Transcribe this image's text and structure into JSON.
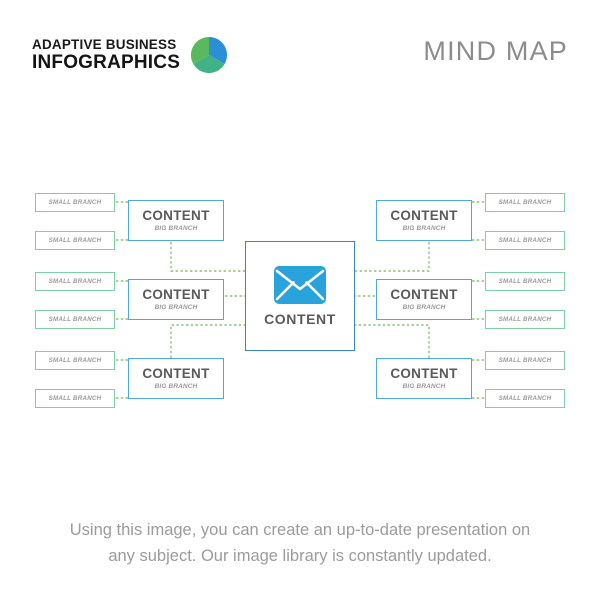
{
  "header": {
    "logo_line1": "ADAPTIVE BUSINESS",
    "logo_line2": "INFOGRAPHICS",
    "logo_icon": "three-segment-circle",
    "title": "MIND MAP",
    "colors": {
      "logo_blue": "#2a8fd4",
      "logo_green": "#5cb85c",
      "logo_teal": "#3fb286",
      "title_gray": "#8c8c8c"
    }
  },
  "diagram": {
    "type": "mind-map",
    "center": {
      "label": "CONTENT",
      "icon": "envelope-icon",
      "border_color": "#3a86b8",
      "icon_color": "#29a3dc"
    },
    "colors": {
      "big_branch_border": "#4eaadd",
      "small_branch_border": "#7ecfa6",
      "connector": "#8dbf79",
      "big_text": "#5a5a5a",
      "sub_text": "#9a9a9a"
    },
    "big_branches": [
      {
        "title": "CONTENT",
        "subtitle": "BIG BRANCH",
        "side": "left",
        "row": 1
      },
      {
        "title": "CONTENT",
        "subtitle": "BIG BRANCH",
        "side": "left",
        "row": 2
      },
      {
        "title": "CONTENT",
        "subtitle": "BIG BRANCH",
        "side": "left",
        "row": 3
      },
      {
        "title": "CONTENT",
        "subtitle": "BIG BRANCH",
        "side": "right",
        "row": 1
      },
      {
        "title": "CONTENT",
        "subtitle": "BIG BRANCH",
        "side": "right",
        "row": 2
      },
      {
        "title": "CONTENT",
        "subtitle": "BIG BRANCH",
        "side": "right",
        "row": 3
      }
    ],
    "small_branches": [
      {
        "label": "SMALL BRANCH",
        "side": "left",
        "row": 1,
        "slot": "upper"
      },
      {
        "label": "SMALL BRANCH",
        "side": "left",
        "row": 1,
        "slot": "lower"
      },
      {
        "label": "SMALL BRANCH",
        "side": "left",
        "row": 2,
        "slot": "upper"
      },
      {
        "label": "SMALL BRANCH",
        "side": "left",
        "row": 2,
        "slot": "lower"
      },
      {
        "label": "SMALL BRANCH",
        "side": "left",
        "row": 3,
        "slot": "upper"
      },
      {
        "label": "SMALL BRANCH",
        "side": "left",
        "row": 3,
        "slot": "lower"
      },
      {
        "label": "SMALL BRANCH",
        "side": "right",
        "row": 1,
        "slot": "upper"
      },
      {
        "label": "SMALL BRANCH",
        "side": "right",
        "row": 1,
        "slot": "lower"
      },
      {
        "label": "SMALL BRANCH",
        "side": "right",
        "row": 2,
        "slot": "upper"
      },
      {
        "label": "SMALL BRANCH",
        "side": "right",
        "row": 2,
        "slot": "lower"
      },
      {
        "label": "SMALL BRANCH",
        "side": "right",
        "row": 3,
        "slot": "upper"
      },
      {
        "label": "SMALL BRANCH",
        "side": "right",
        "row": 3,
        "slot": "lower"
      }
    ]
  },
  "caption": {
    "line1": "Using this image, you can create an up-to-date presentation on",
    "line2": "any subject. Our image library is constantly updated."
  }
}
